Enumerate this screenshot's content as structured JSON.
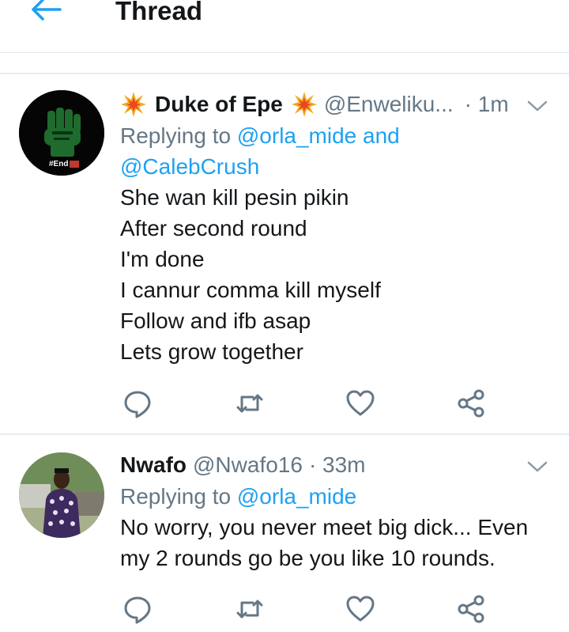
{
  "header": {
    "title": "Thread"
  },
  "tweets": [
    {
      "name": "Duke of Epe",
      "handle": "@Enweliku...",
      "time": "· 1m",
      "reply_prefix": "Replying to",
      "reply_to_1": "@orla_mide and",
      "reply_to_2": "@CalebCrush",
      "avatar_text": "#End",
      "body": [
        "She wan kill pesin pikin",
        "After second round",
        "I'm done",
        "I cannur comma kill myself",
        "Follow and ifb asap",
        "Lets grow together"
      ]
    },
    {
      "name": "Nwafo",
      "handle": "@Nwafo16",
      "time": "· 33m",
      "reply_prefix": "Replying to",
      "reply_to_1": "@orla_mide",
      "body": [
        "No worry, you never meet big dick... Even",
        "my 2 rounds go be you like 10 rounds."
      ]
    }
  ],
  "colors": {
    "accent": "#1da1f2",
    "muted": "#657786",
    "text": "#14171a",
    "border": "#e6ecf0"
  },
  "icons": [
    "back-arrow-icon",
    "explosion-emoji-icon",
    "chevron-down-icon",
    "reply-icon",
    "retweet-icon",
    "like-icon",
    "share-icon"
  ]
}
